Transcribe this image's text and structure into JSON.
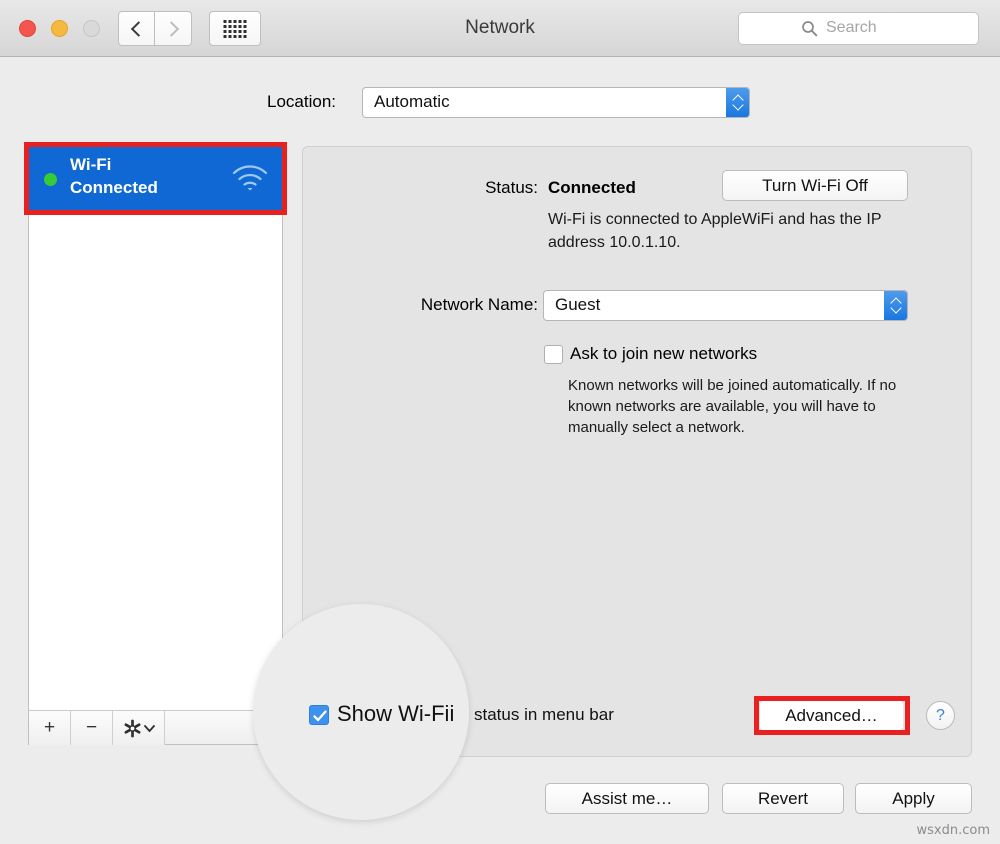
{
  "window": {
    "title": "Network",
    "traffic_lights": [
      "close",
      "minimize",
      "zoom"
    ]
  },
  "toolbar": {
    "back_icon": "chevron-left-icon",
    "forward_icon": "chevron-right-icon",
    "grid_icon": "show-all-grid-icon",
    "search_placeholder": "Search",
    "search_value": "",
    "search_icon": "magnifier-icon"
  },
  "location": {
    "label": "Location:",
    "value": "Automatic"
  },
  "sidebar": {
    "services": [
      {
        "name": "Wi-Fi",
        "status": "Connected",
        "dot_color": "#35cc35",
        "selected": true,
        "icon": "wifi-icon"
      }
    ],
    "footer": {
      "add_label": "+",
      "remove_label": "−",
      "gear_label": "⚙",
      "gear_chevron": "⌄"
    }
  },
  "main": {
    "status_label": "Status:",
    "status_value": "Connected",
    "status_description": "Wi-Fi is connected to AppleWiFi and has the IP address 10.0.1.10.",
    "turn_off_button": "Turn Wi-Fi Off",
    "network_name_label": "Network Name:",
    "network_name_value": "Guest",
    "ask_to_join_label": "Ask to join new networks",
    "ask_to_join_checked": false,
    "ask_to_join_description": "Known networks will be joined automatically. If no known networks are available, you will have to manually select a network.",
    "show_status_checked": true,
    "show_status_label_magnified": "Show Wi-Fii",
    "show_status_label_rest": "status in menu bar",
    "advanced_button": "Advanced…",
    "help_button": "?"
  },
  "footer": {
    "assist_button": "Assist me…",
    "revert_button": "Revert",
    "apply_button": "Apply"
  },
  "annotations": {
    "highlight_color": "#e8201f",
    "highlighted_items": [
      "wifi-sidebar-row",
      "advanced-button"
    ],
    "magnifier_target": "show-wifi-status-checkbox"
  },
  "watermark": "wsxdn.com"
}
